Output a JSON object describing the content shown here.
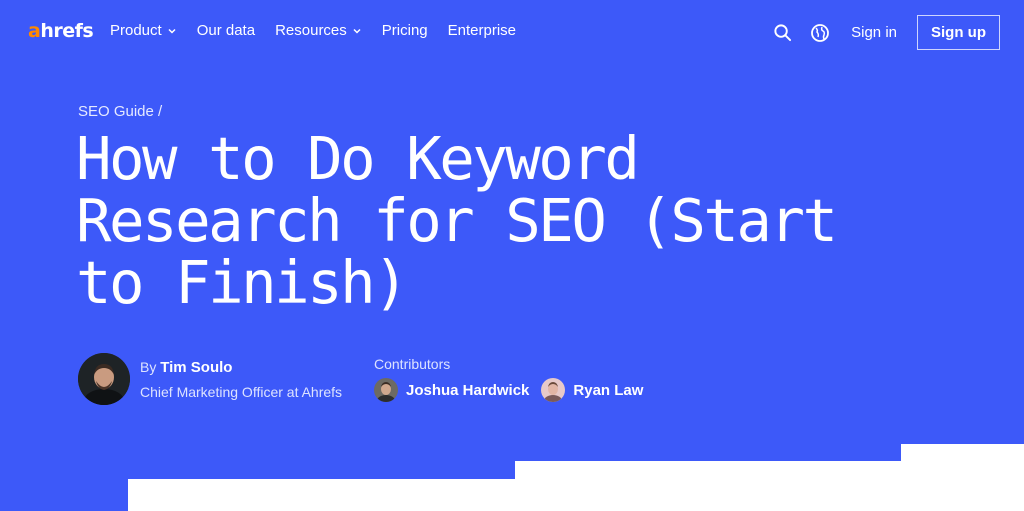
{
  "nav": {
    "logo_accent": "a",
    "logo_rest": "hrefs",
    "links": [
      {
        "label": "Product",
        "has_dropdown": true
      },
      {
        "label": "Our data",
        "has_dropdown": false
      },
      {
        "label": "Resources",
        "has_dropdown": true
      },
      {
        "label": "Pricing",
        "has_dropdown": false
      },
      {
        "label": "Enterprise",
        "has_dropdown": false
      }
    ],
    "sign_in": "Sign in",
    "sign_up": "Sign up"
  },
  "article": {
    "breadcrumb": "SEO Guide /",
    "title": "How to Do Keyword Research for SEO (Start to Finish)",
    "author": {
      "by": "By",
      "name": "Tim Soulo",
      "role": "Chief Marketing Officer at Ahrefs"
    },
    "contributors_label": "Contributors",
    "contributors": [
      {
        "name": "Joshua Hardwick"
      },
      {
        "name": "Ryan Law"
      }
    ]
  },
  "colors": {
    "hero_bg": "#3d59f9",
    "logo_accent": "#ff8800"
  },
  "icons": [
    "search-icon",
    "globe-icon",
    "chevron-down-icon"
  ]
}
